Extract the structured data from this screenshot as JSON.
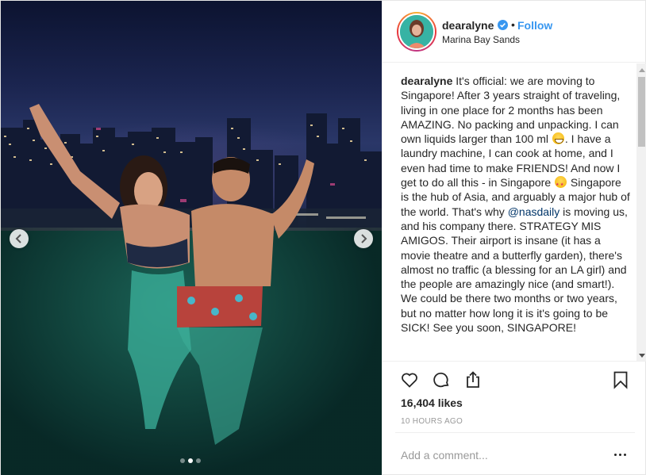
{
  "post": {
    "photo": {
      "prev_icon": "chevron-left-icon",
      "next_icon": "chevron-right-icon",
      "carousel_total": 3,
      "carousel_active": 2
    },
    "header": {
      "username": "dearalyne",
      "verified_icon": "verified-badge-icon",
      "separator": "•",
      "follow_label": "Follow",
      "location": "Marina Bay Sands"
    },
    "caption": {
      "username": "dearalyne",
      "text_1": " It's official: we are moving to Singapore! After 3 years straight of traveling, living in one place for 2 months has been AMAZING. No packing and unpacking. I can own liquids larger than 100 ml ",
      "emoji_1": "grinning-face",
      "text_2": ". I have a laundry machine, I can cook at home, and I even had time to make FRIENDS! And now I get to do all this - in Singapore ",
      "emoji_2": "star-struck-face",
      "text_3": " Singapore is the hub of Asia, and arguably a major hub of the world. That's why ",
      "mention": "@nasdaily",
      "text_4": " is moving us, and his company there. STRATEGY MIS AMIGOS. Their airport is insane (it has a movie theatre and a butterfly garden), there's almost no traffic (a blessing for an LA girl) and the people are amazingly nice (and smart!). We could be there two months or two years, but no matter how long it is it's going to be SICK! See you soon, SINGAPORE!"
    },
    "actions": {
      "like_icon": "heart-icon",
      "comment_icon": "comment-bubble-icon",
      "share_icon": "share-icon",
      "save_icon": "bookmark-icon"
    },
    "likes": "16,404 likes",
    "timestamp": "10 HOURS AGO",
    "comment": {
      "placeholder": "Add a comment...",
      "value": "",
      "more_icon": "more-options-icon"
    }
  },
  "colors": {
    "link": "#3897f0",
    "text": "#262626",
    "muted": "#999999",
    "border": "#efefef",
    "mention": "#003569"
  }
}
